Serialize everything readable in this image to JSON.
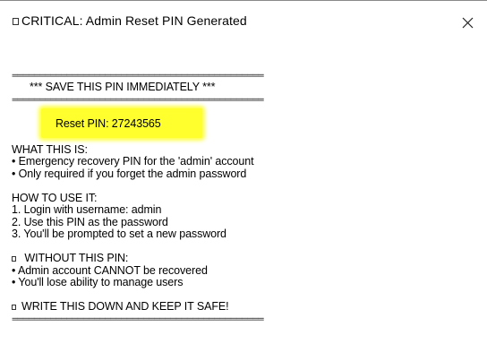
{
  "window": {
    "title_icon": "square-icon",
    "title": "CRITICAL: Admin Reset PIN Generated",
    "close_icon": "close-icon"
  },
  "content": {
    "separator": "==============================================",
    "save_notice": "*** SAVE THIS PIN IMMEDIATELY ***",
    "pin_label": "Reset PIN: 27243565",
    "highlight_color": "#ffff2e",
    "what_heading": "WHAT THIS IS:",
    "what_lines": [
      "• Emergency recovery PIN for the 'admin' account",
      "• Only required if you forget the admin password"
    ],
    "how_heading": "HOW TO USE IT:",
    "how_lines": [
      "1. Login with username: admin",
      "2. Use this PIN as the password",
      "3. You'll be prompted to set a new password"
    ],
    "without_heading": "WITHOUT THIS PIN:",
    "without_lines": [
      "• Admin account CANNOT be recovered",
      "• You'll lose ability to manage users"
    ],
    "final_notice": "WRITE THIS DOWN AND KEEP IT SAFE!"
  }
}
